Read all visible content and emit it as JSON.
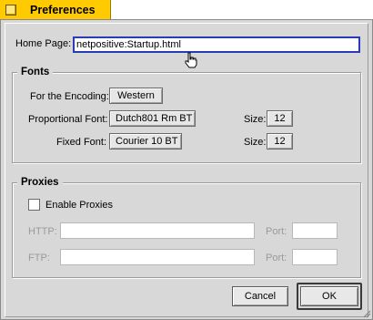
{
  "window": {
    "title": "Preferences"
  },
  "home_page": {
    "label": "Home Page:",
    "value": "netpositive:Startup.html"
  },
  "fonts": {
    "title": "Fonts",
    "encoding_label": "For the Encoding:",
    "encoding_value": "Western",
    "proportional_label": "Proportional Font:",
    "proportional_value": "Dutch801 Rm BT",
    "proportional_size_label": "Size:",
    "proportional_size_value": "12",
    "fixed_label": "Fixed Font:",
    "fixed_value": "Courier 10 BT",
    "fixed_size_label": "Size:",
    "fixed_size_value": "12"
  },
  "proxies": {
    "title": "Proxies",
    "enable_label": "Enable Proxies",
    "enable_checked": false,
    "http_label": "HTTP:",
    "http_value": "",
    "http_port_label": "Port:",
    "http_port_value": "",
    "ftp_label": "FTP:",
    "ftp_value": "",
    "ftp_port_label": "Port:",
    "ftp_port_value": ""
  },
  "buttons": {
    "cancel": "Cancel",
    "ok": "OK"
  },
  "colors": {
    "tab": "#ffcb00",
    "window_bg": "#d8d8d8",
    "focus": "#2a3bb5",
    "disabled_text": "#9a9a9a"
  },
  "icons": {
    "close": "close-box-icon",
    "cursor": "hand-pointer-icon",
    "resize": "resize-grip-icon"
  }
}
